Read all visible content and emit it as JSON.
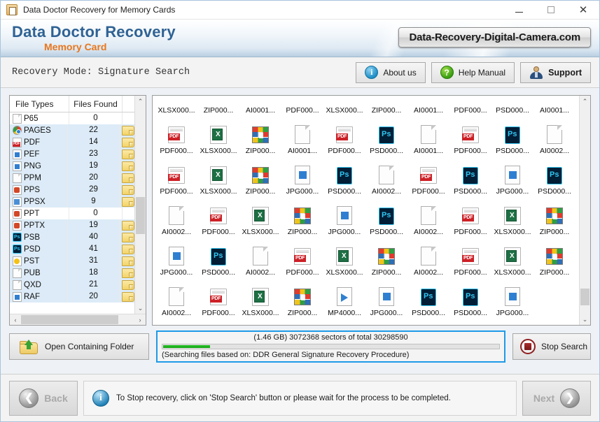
{
  "window": {
    "title": "Data Doctor Recovery for Memory Cards",
    "app_icon": "app-document-icon",
    "minimize": "—",
    "maximize": "□",
    "close": "✕"
  },
  "brand": {
    "main": "Data Doctor Recovery",
    "sub": "Memory Card",
    "url_plate": "Data-Recovery-Digital-Camera.com",
    "main_color": "#2f6294",
    "sub_color": "#e8761c"
  },
  "mode_bar": {
    "label": "Recovery Mode:  Signature Search",
    "buttons": [
      {
        "label": "About us",
        "icon": "info-icon"
      },
      {
        "label": "Help Manual",
        "icon": "question-icon"
      },
      {
        "label": "Support",
        "icon": "support-person-icon"
      }
    ]
  },
  "file_types_panel": {
    "headers": {
      "type": "File Types",
      "found": "Files Found",
      "bar": ""
    },
    "rows": [
      {
        "name": "P65",
        "count": "0",
        "icon": "blank",
        "selected": false,
        "bar": false
      },
      {
        "name": "PAGES",
        "count": "22",
        "icon": "chrome",
        "selected": true,
        "bar": true
      },
      {
        "name": "PDF",
        "count": "14",
        "icon": "pdf",
        "selected": true,
        "bar": true
      },
      {
        "name": "PEF",
        "count": "23",
        "icon": "img",
        "selected": true,
        "bar": true
      },
      {
        "name": "PNG",
        "count": "19",
        "icon": "img",
        "selected": true,
        "bar": true
      },
      {
        "name": "PPM",
        "count": "20",
        "icon": "blank",
        "selected": true,
        "bar": true
      },
      {
        "name": "PPS",
        "count": "29",
        "icon": "ppt",
        "selected": true,
        "bar": true
      },
      {
        "name": "PPSX",
        "count": "9",
        "icon": "ppsx",
        "selected": true,
        "bar": true
      },
      {
        "name": "PPT",
        "count": "0",
        "icon": "ppt",
        "selected": false,
        "bar": false
      },
      {
        "name": "PPTX",
        "count": "19",
        "icon": "ppt",
        "selected": true,
        "bar": true
      },
      {
        "name": "PSB",
        "count": "40",
        "icon": "ps",
        "selected": true,
        "bar": true
      },
      {
        "name": "PSD",
        "count": "41",
        "icon": "ps",
        "selected": true,
        "bar": true
      },
      {
        "name": "PST",
        "count": "31",
        "icon": "pst",
        "selected": true,
        "bar": true
      },
      {
        "name": "PUB",
        "count": "18",
        "icon": "blank",
        "selected": true,
        "bar": true
      },
      {
        "name": "QXD",
        "count": "21",
        "icon": "blank",
        "selected": true,
        "bar": true
      },
      {
        "name": "RAF",
        "count": "20",
        "icon": "img",
        "selected": true,
        "bar": true
      }
    ],
    "scroll_up": "⌃",
    "scroll_down": "⌄",
    "scroll_left": "‹",
    "scroll_right": "›"
  },
  "file_grid": {
    "scroll_up": "⌃",
    "scroll_down": "⌄",
    "rows": [
      [
        {
          "label": "XLSX000...",
          "icon": "xlsx"
        },
        {
          "label": "ZIP000...",
          "icon": "zip"
        },
        {
          "label": "AI0001...",
          "icon": "ai"
        },
        {
          "label": "PDF000...",
          "icon": "pdf"
        },
        {
          "label": "XLSX000...",
          "icon": "xlsx"
        },
        {
          "label": "ZIP000...",
          "icon": "zip"
        },
        {
          "label": "AI0001...",
          "icon": "ai"
        },
        {
          "label": "PDF000...",
          "icon": "pdf"
        },
        {
          "label": "PSD000...",
          "icon": "psd"
        },
        {
          "label": "AI0001...",
          "icon": "ai"
        }
      ],
      [
        {
          "label": "PDF000...",
          "icon": "pdf"
        },
        {
          "label": "XLSX000...",
          "icon": "xlsx"
        },
        {
          "label": "ZIP000...",
          "icon": "zip"
        },
        {
          "label": "AI0001...",
          "icon": "ai"
        },
        {
          "label": "PDF000...",
          "icon": "pdf"
        },
        {
          "label": "PSD000...",
          "icon": "psd"
        },
        {
          "label": "AI0001...",
          "icon": "ai"
        },
        {
          "label": "PDF000...",
          "icon": "pdf"
        },
        {
          "label": "PSD000...",
          "icon": "psd"
        },
        {
          "label": "AI0002...",
          "icon": "ai"
        }
      ],
      [
        {
          "label": "PDF000...",
          "icon": "pdf"
        },
        {
          "label": "XLSX000...",
          "icon": "xlsx"
        },
        {
          "label": "ZIP000...",
          "icon": "zip"
        },
        {
          "label": "JPG000...",
          "icon": "jpg"
        },
        {
          "label": "PSD000...",
          "icon": "psd"
        },
        {
          "label": "AI0002...",
          "icon": "ai"
        },
        {
          "label": "PDF000...",
          "icon": "pdf"
        },
        {
          "label": "PSD000...",
          "icon": "psd"
        },
        {
          "label": "JPG000...",
          "icon": "jpg"
        },
        {
          "label": "PSD000...",
          "icon": "psd"
        }
      ],
      [
        {
          "label": "AI0002...",
          "icon": "ai"
        },
        {
          "label": "PDF000...",
          "icon": "pdf"
        },
        {
          "label": "XLSX000...",
          "icon": "xlsx"
        },
        {
          "label": "ZIP000...",
          "icon": "zip"
        },
        {
          "label": "JPG000...",
          "icon": "jpg"
        },
        {
          "label": "PSD000...",
          "icon": "psd"
        },
        {
          "label": "AI0002...",
          "icon": "ai"
        },
        {
          "label": "PDF000...",
          "icon": "pdf"
        },
        {
          "label": "XLSX000...",
          "icon": "xlsx"
        },
        {
          "label": "ZIP000...",
          "icon": "zip"
        }
      ],
      [
        {
          "label": "JPG000...",
          "icon": "jpg"
        },
        {
          "label": "PSD000...",
          "icon": "psd"
        },
        {
          "label": "AI0002...",
          "icon": "ai"
        },
        {
          "label": "PDF000...",
          "icon": "pdf"
        },
        {
          "label": "XLSX000...",
          "icon": "xlsx"
        },
        {
          "label": "ZIP000...",
          "icon": "zip"
        },
        {
          "label": "AI0002...",
          "icon": "ai"
        },
        {
          "label": "PDF000...",
          "icon": "pdf"
        },
        {
          "label": "XLSX000...",
          "icon": "xlsx"
        },
        {
          "label": "ZIP000...",
          "icon": "zip"
        }
      ],
      [
        {
          "label": "AI0002...",
          "icon": "ai"
        },
        {
          "label": "PDF000...",
          "icon": "pdf"
        },
        {
          "label": "XLSX000...",
          "icon": "xlsx"
        },
        {
          "label": "ZIP000...",
          "icon": "zip"
        },
        {
          "label": "MP4000...",
          "icon": "mp4"
        },
        {
          "label": "JPG000...",
          "icon": "jpg"
        },
        {
          "label": "PSD000...",
          "icon": "psd"
        },
        {
          "label": "PSD000...",
          "icon": "psd"
        },
        {
          "label": "JPG000...",
          "icon": "jpg"
        },
        {
          "label": "",
          "icon": "none"
        }
      ]
    ]
  },
  "actions": {
    "open_folder_label": "Open Containing Folder",
    "stop_label": "Stop Search",
    "progress": {
      "top_text": "(1.46 GB) 3072368  sectors  of  total 30298590",
      "bottom_text": "(Searching files based on:  DDR General Signature Recovery Procedure)",
      "percent": 14,
      "fill_color": "#17ab17",
      "border_color": "#1e9ae8"
    }
  },
  "footer": {
    "back_label": "Back",
    "next_label": "Next",
    "back_icon": "❮",
    "next_icon": "❯",
    "message": "To Stop recovery, click on 'Stop Search' button or please wait for the process to be completed.",
    "message_icon": "info-icon"
  }
}
